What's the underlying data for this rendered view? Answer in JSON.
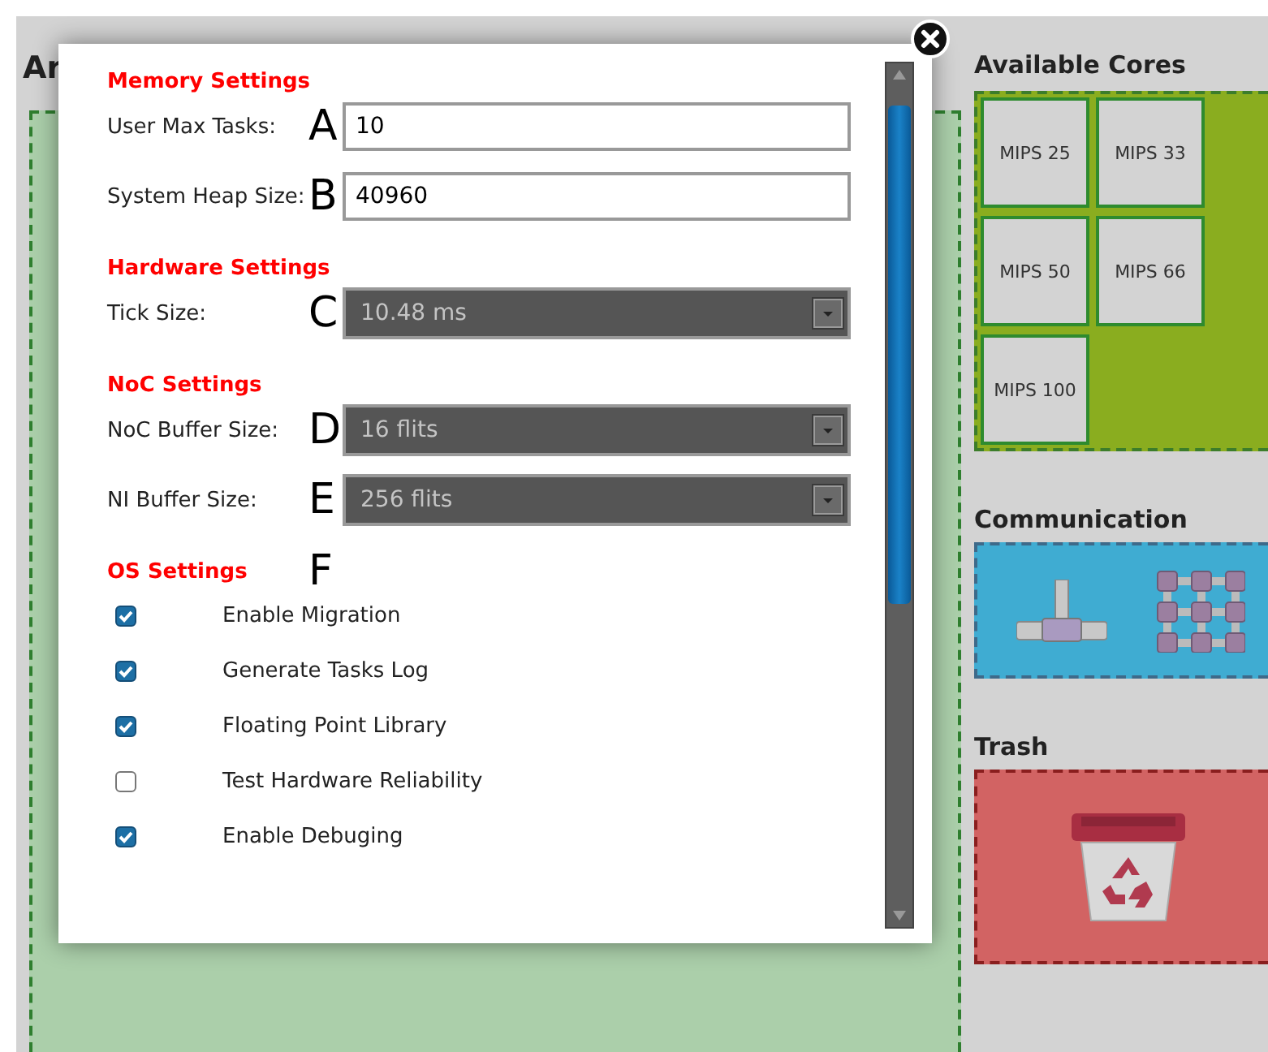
{
  "workspace": {
    "title": "Ar"
  },
  "dialog": {
    "sections": [
      {
        "title": "Memory Settings",
        "fields": [
          {
            "kind": "input",
            "label": "User Max Tasks:",
            "marker": "A",
            "value": "10"
          },
          {
            "kind": "input",
            "label": "System Heap Size:",
            "marker": "B",
            "value": "40960"
          }
        ]
      },
      {
        "title": "Hardware Settings",
        "fields": [
          {
            "kind": "select",
            "label": "Tick Size:",
            "marker": "C",
            "value": "10.48 ms"
          }
        ]
      },
      {
        "title": "NoC Settings",
        "fields": [
          {
            "kind": "select",
            "label": "NoC Buffer Size:",
            "marker": "D",
            "value": "16 flits"
          },
          {
            "kind": "select",
            "label": "NI Buffer Size:",
            "marker": "E",
            "value": "256 flits"
          }
        ]
      },
      {
        "title": "OS Settings",
        "marker": "F",
        "options": [
          {
            "label": "Enable Migration",
            "checked": true
          },
          {
            "label": "Generate Tasks Log",
            "checked": true
          },
          {
            "label": "Floating Point Library",
            "checked": true
          },
          {
            "label": "Test Hardware Reliability",
            "checked": false
          },
          {
            "label": "Enable Debuging",
            "checked": true
          }
        ]
      }
    ]
  },
  "cores": {
    "title": "Available Cores",
    "items": [
      "MIPS 25",
      "MIPS 33",
      "MIPS 50",
      "MIPS 66",
      "MIPS 100"
    ]
  },
  "communication": {
    "title": "Communication"
  },
  "trash": {
    "title": "Trash"
  }
}
